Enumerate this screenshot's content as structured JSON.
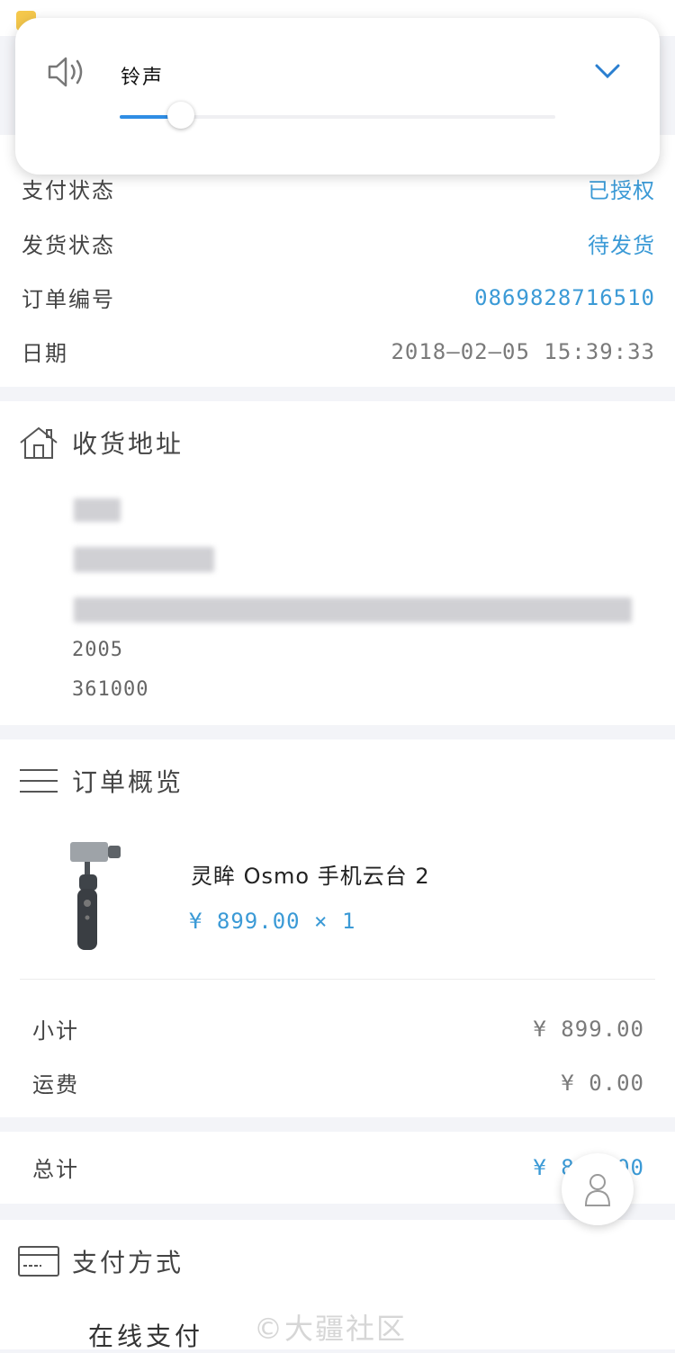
{
  "volume_popup": {
    "label": "铃声",
    "level_percent": 14
  },
  "status_section": {
    "rows": [
      {
        "label": "支付状态",
        "value": "已授权"
      },
      {
        "label": "发货状态",
        "value": "待发货"
      },
      {
        "label": "订单编号",
        "value": "0869828716510"
      },
      {
        "label": "日期",
        "value": "2018—02—05 15:39:33"
      }
    ]
  },
  "address_section": {
    "title": "收货地址",
    "line_postal1": "2005",
    "line_postal2": "361000"
  },
  "order_section": {
    "title": "订单概览",
    "product_name": "灵眸 Osmo 手机云台 2",
    "product_price": "¥ 899.00 × 1",
    "subtotal_label": "小计",
    "subtotal_value": "¥ 899.00",
    "shipping_label": "运费",
    "shipping_value": "¥ 0.00"
  },
  "total_section": {
    "label": "总计",
    "value": "¥ 899.00"
  },
  "payment_section": {
    "title": "支付方式",
    "method": "在线支付"
  },
  "watermark": "©大疆社区",
  "colors": {
    "accent": "#3b9ad6",
    "background": "#f3f4f8"
  }
}
